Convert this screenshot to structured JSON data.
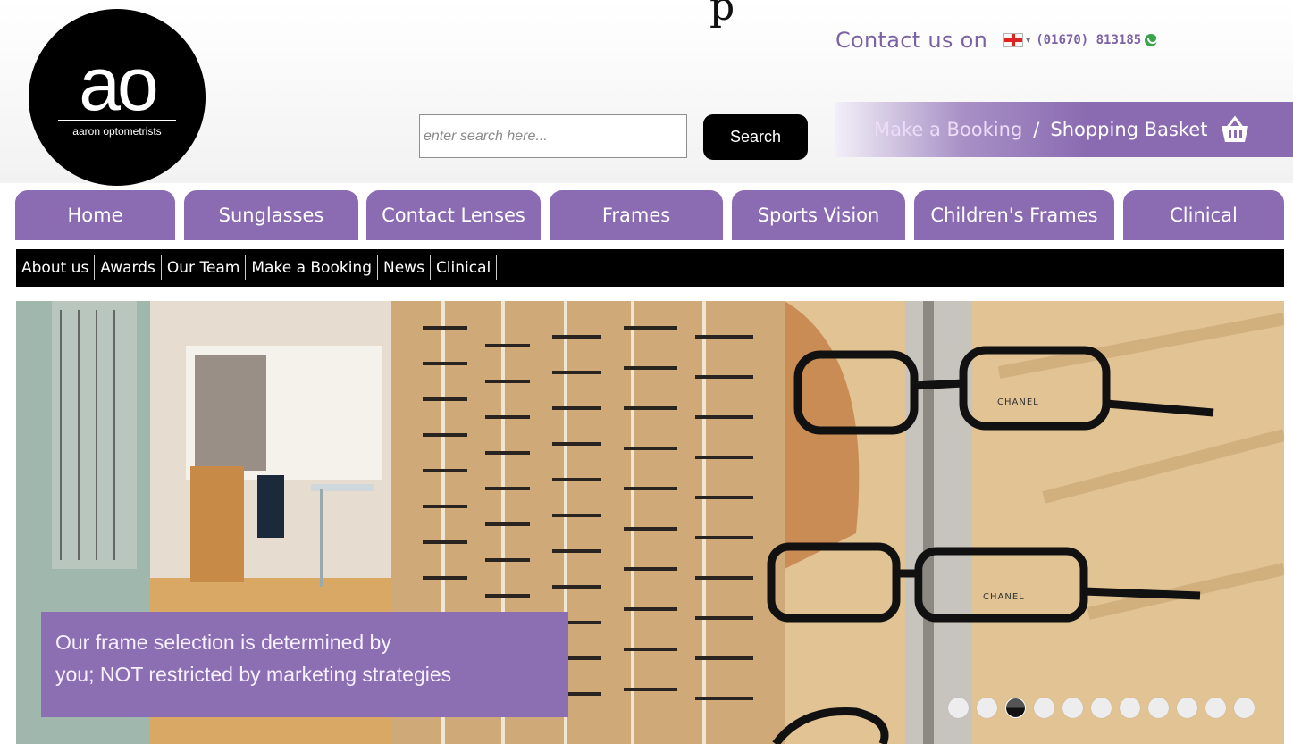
{
  "header": {
    "top_glyph": "p",
    "logo": {
      "mark": "ao",
      "name": "aaron optometrists"
    },
    "contact": {
      "label": "Contact us on",
      "phone": "(01670) 813185"
    },
    "search": {
      "placeholder": "enter search here...",
      "button_label": "Search"
    },
    "booking": {
      "make_booking": "Make a Booking",
      "separator": "/",
      "basket": "Shopping Basket"
    }
  },
  "nav": {
    "tabs": [
      {
        "label": "Home"
      },
      {
        "label": "Sunglasses"
      },
      {
        "label": "Contact Lenses"
      },
      {
        "label": "Frames"
      },
      {
        "label": "Sports Vision"
      },
      {
        "label": "Children's Frames"
      },
      {
        "label": "Clinical"
      }
    ]
  },
  "subnav": {
    "links": [
      {
        "label": "About us"
      },
      {
        "label": "Awards"
      },
      {
        "label": "Our Team"
      },
      {
        "label": "Make a Booking"
      },
      {
        "label": "News"
      },
      {
        "label": "Clinical"
      }
    ]
  },
  "hero": {
    "caption_line1": "Our frame selection is determined by",
    "caption_line2": "you; NOT restricted by marketing strategies",
    "brand_labels": [
      "CHANEL",
      "CHANEL"
    ],
    "slide_count": 11,
    "active_slide": 3
  },
  "colors": {
    "brand_purple": "#8b6bb2",
    "nav_black": "#000000",
    "contact_purple": "#7c62a4"
  }
}
